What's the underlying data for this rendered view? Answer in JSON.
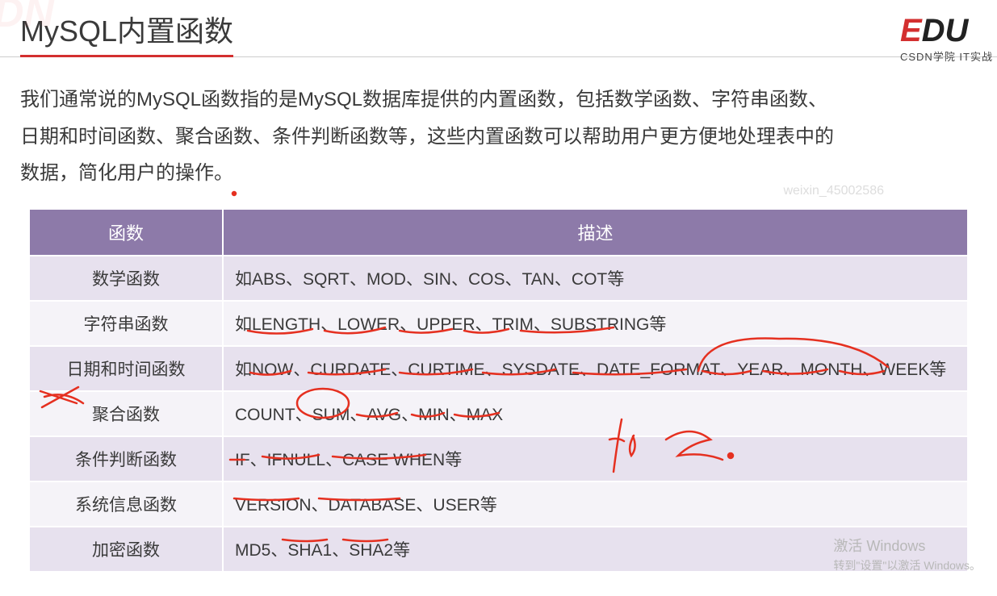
{
  "title": "MySQL内置函数",
  "logo": {
    "part1": "E",
    "part2": "DU",
    "sub": "CSDN学院    IT实战"
  },
  "intro": "我们通常说的MySQL函数指的是MySQL数据库提供的内置函数，包括数学函数、字符串函数、日期和时间函数、聚合函数、条件判断函数等，这些内置函数可以帮助用户更方便地处理表中的数据，简化用户的操作。",
  "watermark_user": "weixin_45002586",
  "table": {
    "headers": [
      "函数",
      "描述"
    ],
    "rows": [
      {
        "fn": "数学函数",
        "desc": "如ABS、SQRT、MOD、SIN、COS、TAN、COT等"
      },
      {
        "fn": "字符串函数",
        "desc": "如LENGTH、LOWER、UPPER、TRIM、SUBSTRING等"
      },
      {
        "fn": "日期和时间函数",
        "desc": "如NOW、CURDATE、CURTIME、SYSDATE、DATE_FORMAT、YEAR、MONTH、WEEK等"
      },
      {
        "fn": "聚合函数",
        "desc": "COUNT、SUM、AVG、MIN、MAX"
      },
      {
        "fn": "条件判断函数",
        "desc": "IF、IFNULL、CASE WHEN等"
      },
      {
        "fn": "系统信息函数",
        "desc": "VERSION、DATABASE、USER等"
      },
      {
        "fn": "加密函数",
        "desc": "MD5、SHA1、SHA2等"
      }
    ]
  },
  "watermark_os": {
    "title": "激活 Windows",
    "sub": "转到\"设置\"以激活 Windows。"
  },
  "annotation_handwriting": "if els."
}
